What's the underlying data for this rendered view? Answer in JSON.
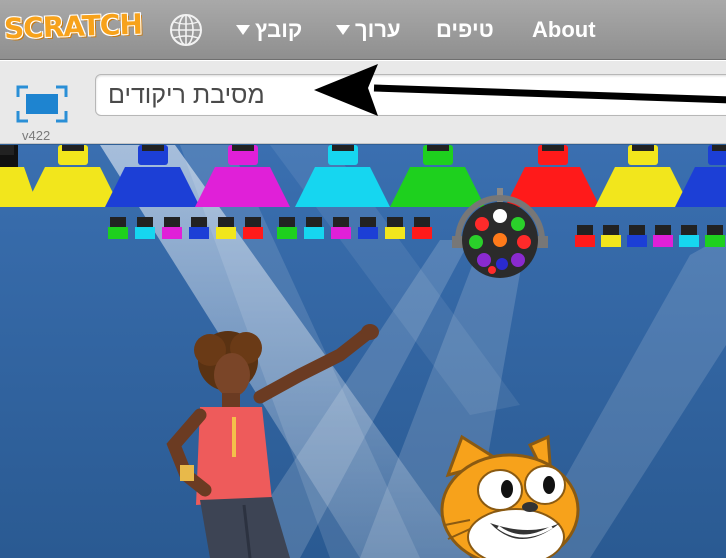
{
  "menubar": {
    "logo": "SCRATCH",
    "globe_icon": "globe-icon",
    "menus": [
      {
        "label": "קובץ",
        "has_caret": true
      },
      {
        "label": "ערוך",
        "has_caret": true
      },
      {
        "label": "טיפים",
        "has_caret": false
      },
      {
        "label": "About",
        "has_caret": false
      }
    ]
  },
  "title_strip": {
    "project_title": "מסיבת ריקודים",
    "version": "v422",
    "fullscreen_icon": "fullscreen-icon"
  },
  "stage": {
    "scene": "dance-party",
    "sprites": [
      "dancer",
      "scratch-cat",
      "disco-ball"
    ],
    "spotlight_colors": [
      "#f7e600",
      "#1c3fd6",
      "#e020d8",
      "#16d6f0",
      "#1ed01e",
      "#ff1a1a",
      "#f7e600",
      "#1c3fd6"
    ]
  },
  "colors": {
    "menubar": "#999999",
    "logo": "#f7a21b",
    "accent_blue": "#1e8fd8"
  }
}
